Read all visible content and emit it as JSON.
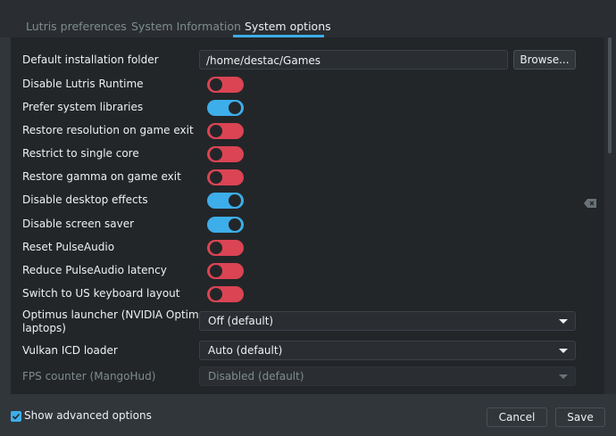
{
  "tabs": [
    {
      "label": "Lutris preferences"
    },
    {
      "label": "System Information"
    },
    {
      "label": "System options",
      "active": true
    }
  ],
  "settings": {
    "install_folder": {
      "label": "Default installation folder",
      "value": "/home/destac/Games",
      "browse_label": "Browse..."
    },
    "toggles": [
      {
        "label": "Disable Lutris Runtime",
        "on": false
      },
      {
        "label": "Prefer system libraries",
        "on": true
      },
      {
        "label": "Restore resolution on game exit",
        "on": false
      },
      {
        "label": "Restrict to single core",
        "on": false
      },
      {
        "label": "Restore gamma on game exit",
        "on": false
      },
      {
        "label": "Disable desktop effects",
        "on": true
      },
      {
        "label": "Disable screen saver",
        "on": true
      },
      {
        "label": "Reset PulseAudio",
        "on": false
      },
      {
        "label": "Reduce PulseAudio latency",
        "on": false
      },
      {
        "label": "Switch to US keyboard layout",
        "on": false
      }
    ],
    "optimus": {
      "label_line1": "Optimus launcher (NVIDIA Optimus",
      "label_line2": "laptops)",
      "value": "Off (default)"
    },
    "vulkan": {
      "label": "Vulkan ICD loader",
      "value": "Auto (default)"
    },
    "fps": {
      "label": "FPS counter (MangoHud)",
      "value": "Disabled (default)",
      "disabled": true
    }
  },
  "footer": {
    "show_advanced_label": "Show advanced options",
    "show_advanced_checked": true,
    "cancel_label": "Cancel",
    "save_label": "Save"
  },
  "colors": {
    "accent": "#3daee9",
    "toggle_off": "#da4453",
    "background": "#31363b",
    "panel": "#232629"
  },
  "icons": {
    "clear": "backspace-clear-icon",
    "dropdown": "chevron-down-icon",
    "check": "checkmark-icon"
  }
}
